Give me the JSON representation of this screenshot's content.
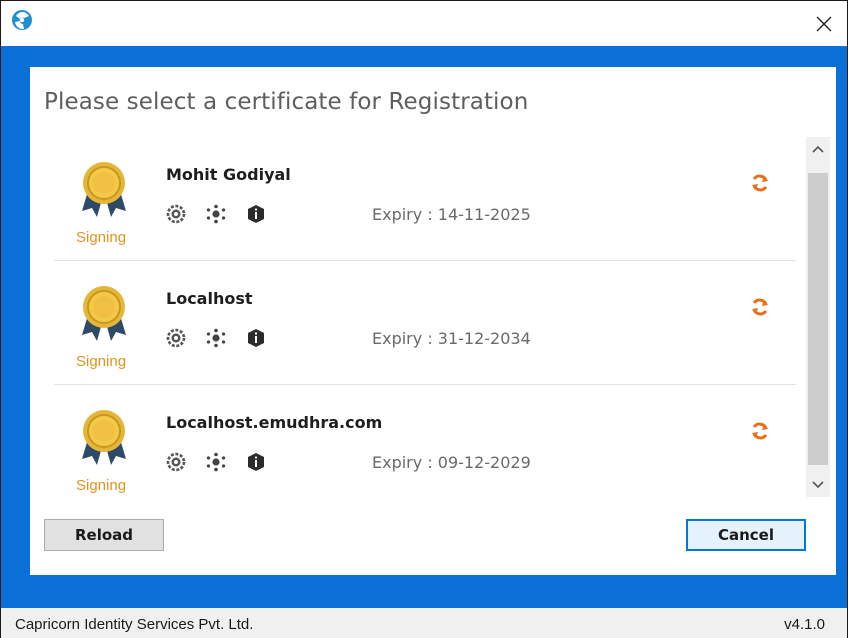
{
  "window": {
    "close_glyph": "✕",
    "accent_color": "#0a6fd6"
  },
  "dialog": {
    "heading": "Please select a certificate for Registration"
  },
  "certificates": [
    {
      "name": "Mohit Godiyal",
      "badge_label": "Signing",
      "expiry": "Expiry : 14-11-2025"
    },
    {
      "name": "Localhost",
      "badge_label": "Signing",
      "expiry": "Expiry : 31-12-2034"
    },
    {
      "name": "Localhost.emudhra.com",
      "badge_label": "Signing",
      "expiry": "Expiry : 09-12-2029"
    }
  ],
  "icons": {
    "app": "app-logo-icon",
    "badge": "award-medal-icon",
    "cert_icons": [
      "settings-gear-icon",
      "network-nodes-icon",
      "info-shield-icon"
    ],
    "refresh": "refresh-icon",
    "scroll_up": "chevron-up-icon",
    "scroll_down": "chevron-down-icon"
  },
  "buttons": {
    "reload": "Reload",
    "cancel": "Cancel"
  },
  "footer": {
    "company": "Capricorn Identity Services Pvt. Ltd.",
    "version": "v4.1.0"
  },
  "colors": {
    "badge_label": "#e0931b",
    "refresh": "#e8701a",
    "frame": "#0a6fd6"
  }
}
